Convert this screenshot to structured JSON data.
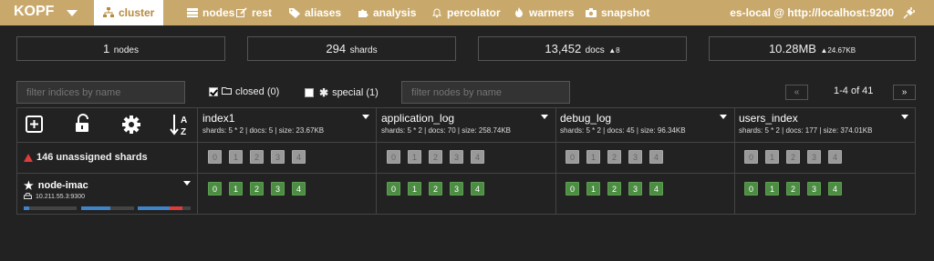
{
  "navbar": {
    "brand": "KOPF",
    "items": [
      {
        "label": "cluster",
        "icon": "cluster-icon",
        "active": true
      },
      {
        "label": "nodes",
        "icon": "nodes-icon",
        "active": false
      },
      {
        "label": "rest",
        "icon": "rest-icon",
        "active": false
      },
      {
        "label": "aliases",
        "icon": "tag-icon",
        "active": false
      },
      {
        "label": "analysis",
        "icon": "puzzle-icon",
        "active": false
      },
      {
        "label": "percolator",
        "icon": "bell-icon",
        "active": false
      },
      {
        "label": "warmers",
        "icon": "fire-icon",
        "active": false
      },
      {
        "label": "snapshot",
        "icon": "camera-icon",
        "active": false
      }
    ],
    "connection": "es-local @ http://localhost:9200",
    "accent": "#c9a96b"
  },
  "stats": {
    "nodes": {
      "value": "1",
      "label": "nodes"
    },
    "shards": {
      "value": "294",
      "label": "shards"
    },
    "docs": {
      "value": "13,452",
      "label": "docs",
      "delta": "8"
    },
    "size": {
      "value": "10.28MB",
      "delta": "24.67KB"
    }
  },
  "filters": {
    "indices_placeholder": "filter indices by name",
    "closed_label": "closed (0)",
    "closed_checked": true,
    "special_label": "special (1)",
    "special_checked": false,
    "nodes_placeholder": "filter nodes by name"
  },
  "pagination": {
    "prev": "«",
    "text": "1-4 of 41",
    "next": "»"
  },
  "indices": [
    {
      "name": "index1",
      "meta": "shards: 5 * 2 | docs: 5 | size: 23.67KB",
      "unassigned": [
        "0",
        "1",
        "2",
        "3",
        "4"
      ],
      "started": [
        "0",
        "1",
        "2",
        "3",
        "4"
      ]
    },
    {
      "name": "application_log",
      "meta": "shards: 5 * 2 | docs: 70 | size: 258.74KB",
      "unassigned": [
        "0",
        "1",
        "2",
        "3",
        "4"
      ],
      "started": [
        "0",
        "1",
        "2",
        "3",
        "4"
      ]
    },
    {
      "name": "debug_log",
      "meta": "shards: 5 * 2 | docs: 45 | size: 96.34KB",
      "unassigned": [
        "0",
        "1",
        "2",
        "3",
        "4"
      ],
      "started": [
        "0",
        "1",
        "2",
        "3",
        "4"
      ]
    },
    {
      "name": "users_index",
      "meta": "shards: 5 * 2 | docs: 177 | size: 374.01KB",
      "unassigned": [
        "0",
        "1",
        "2",
        "3",
        "4"
      ],
      "started": [
        "0",
        "1",
        "2",
        "3",
        "4"
      ]
    }
  ],
  "unassigned": {
    "label": "146 unassigned shards"
  },
  "node": {
    "name": "node-imac",
    "ip": "10.211.55.3:9300",
    "usage": [
      {
        "fraction": 0.1,
        "color": "#3f83c8"
      },
      {
        "fraction": 0.55,
        "color": "#3f83c8"
      },
      {
        "fraction": 0.6,
        "color": "#3f83c8",
        "extra_fraction": 0.25,
        "extra_color": "#e03b3b"
      }
    ]
  }
}
